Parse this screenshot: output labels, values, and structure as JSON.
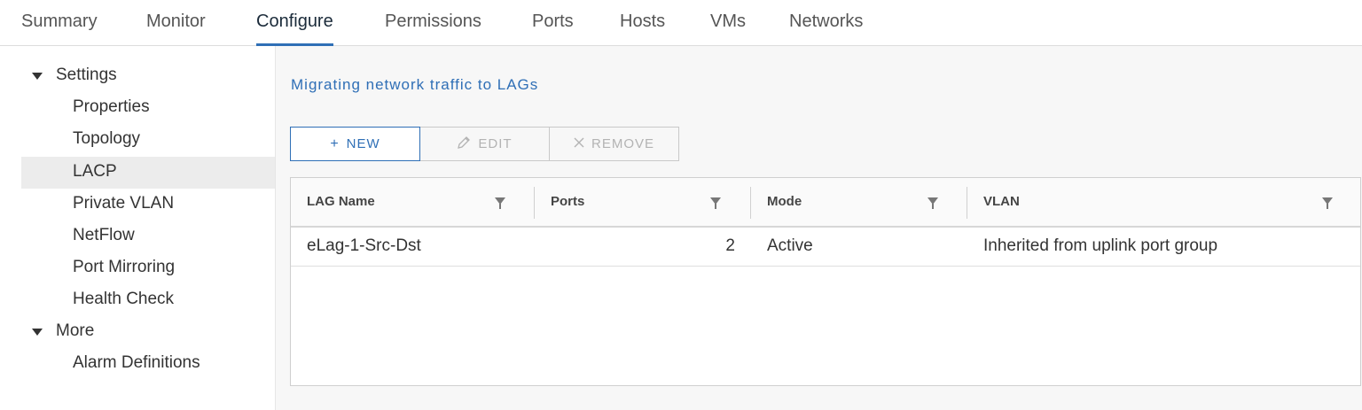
{
  "tabs": [
    {
      "label": "Summary"
    },
    {
      "label": "Monitor"
    },
    {
      "label": "Configure"
    },
    {
      "label": "Permissions"
    },
    {
      "label": "Ports"
    },
    {
      "label": "Hosts"
    },
    {
      "label": "VMs"
    },
    {
      "label": "Networks"
    }
  ],
  "active_tab": "Configure",
  "sidebar": {
    "groups": [
      {
        "label": "Settings",
        "items": [
          "Properties",
          "Topology",
          "LACP",
          "Private VLAN",
          "NetFlow",
          "Port Mirroring",
          "Health Check"
        ]
      },
      {
        "label": "More",
        "items": [
          "Alarm Definitions"
        ]
      }
    ],
    "selected": "LACP"
  },
  "main": {
    "title": "Migrating network traffic to LAGs",
    "buttons": {
      "new": "NEW",
      "edit": "EDIT",
      "remove": "REMOVE"
    },
    "table": {
      "columns": [
        "LAG Name",
        "Ports",
        "Mode",
        "VLAN"
      ],
      "rows": [
        {
          "lag_name": "eLag-1-Src-Dst",
          "ports": "2",
          "mode": "Active",
          "vlan": "Inherited from uplink port group"
        }
      ]
    }
  },
  "colors": {
    "accent": "#2f6fb6",
    "selected_bg": "#ececec",
    "panel_bg": "#f7f7f7"
  }
}
